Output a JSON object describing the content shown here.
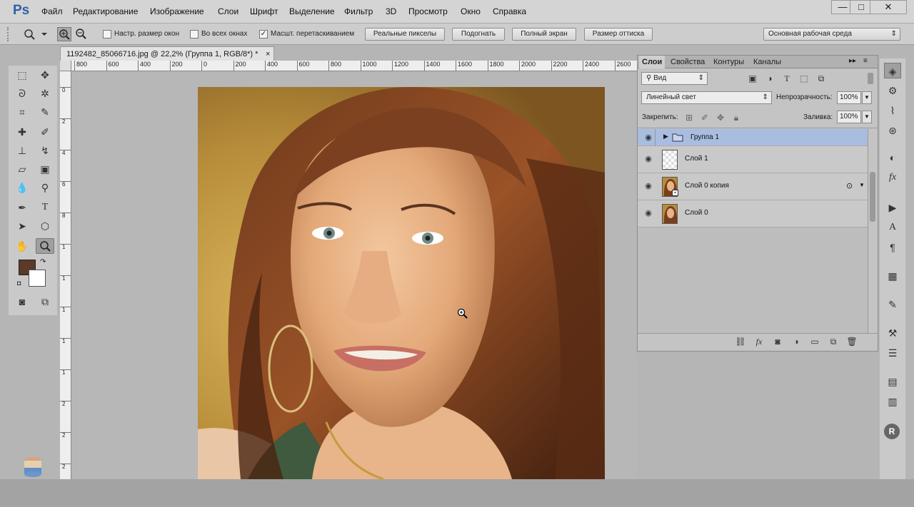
{
  "app": {
    "logo": "Ps"
  },
  "menu": [
    "Файл",
    "Редактирование",
    "Изображение",
    "Слои",
    "Шрифт",
    "Выделение",
    "Фильтр",
    "3D",
    "Просмотр",
    "Окно",
    "Справка"
  ],
  "window_controls": {
    "minimize": "—",
    "maximize": "□",
    "close": "✕"
  },
  "options": {
    "resize_windows": "Настр. размер окон",
    "all_windows": "Во всех окнах",
    "scrubby_zoom": "Масшт. перетаскиванием",
    "scrubby_checked": "✓",
    "actual_pixels": "Реальные пикселы",
    "fit_screen": "Подогнать",
    "fill_screen": "Полный экран",
    "print_size": "Размер оттиска",
    "workspace": "Основная рабочая среда"
  },
  "document": {
    "tab_title": "1192482_85066716.jpg @ 22,2% (Группа 1, RGB/8*) *",
    "close": "×"
  },
  "ruler": {
    "h": [
      "800",
      "600",
      "400",
      "200",
      "0",
      "200",
      "400",
      "600",
      "800",
      "1000",
      "1200",
      "1400",
      "1600",
      "1800",
      "2000",
      "2200",
      "2400",
      "2600"
    ],
    "v": [
      "0",
      "2",
      "4",
      "6",
      "8",
      "1",
      "1",
      "1",
      "1",
      "1",
      "2",
      "2",
      "2"
    ]
  },
  "colors": {
    "foreground": "#5b3a27",
    "background": "#ffffff",
    "selection": "#a8bde0"
  },
  "panel": {
    "tabs": [
      "Слои",
      "Свойства",
      "Контуры",
      "Каналы"
    ],
    "filter_label": "Вид",
    "blend_mode": "Линейный свет",
    "opacity_label": "Непрозрачность:",
    "opacity_value": "100%",
    "lock_label": "Закрепить:",
    "fill_label": "Заливка:",
    "fill_value": "100%",
    "layers": [
      {
        "name": "Группа 1",
        "type": "group"
      },
      {
        "name": "Слой 1",
        "type": "empty"
      },
      {
        "name": "Слой 0 копия",
        "type": "photo"
      },
      {
        "name": "Слой 0",
        "type": "photo"
      }
    ]
  }
}
